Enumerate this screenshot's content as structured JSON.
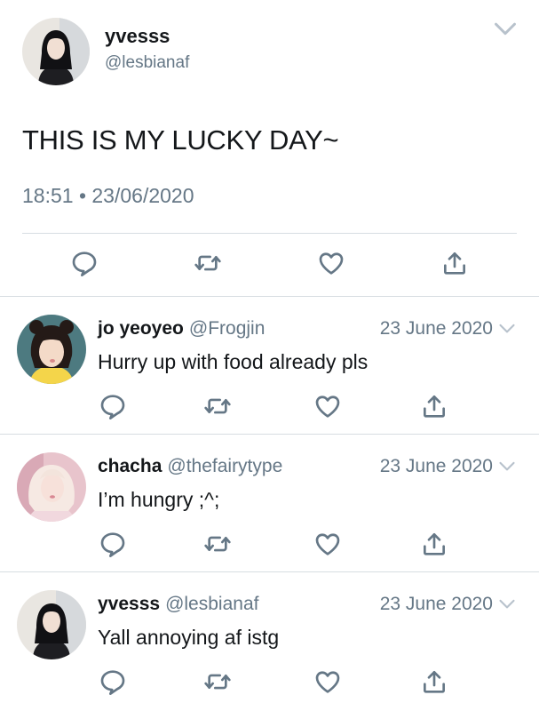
{
  "main_tweet": {
    "name": "yvesss",
    "handle": "@lesbianaf",
    "text": "THIS IS MY LUCKY DAY~",
    "meta": "18:51 • 23/06/2020"
  },
  "replies": [
    {
      "name": "jo yeoyeo",
      "handle": "@Frogjin",
      "date": "23 June 2020",
      "text": "Hurry up with food already pls"
    },
    {
      "name": "chacha",
      "handle": "@thefairytype",
      "date": "23 June 2020",
      "text": "I’m hungry ;^;"
    },
    {
      "name": "yvesss",
      "handle": "@lesbianaf",
      "date": "23 June 2020",
      "text": "Yall annoying af istg"
    }
  ],
  "colors": {
    "text": "#14171a",
    "secondary": "#657786",
    "icon": "#657786",
    "divider": "#d7dde2"
  },
  "icons": [
    "reply-icon",
    "retweet-icon",
    "like-icon",
    "share-icon",
    "chevron-down-icon"
  ]
}
